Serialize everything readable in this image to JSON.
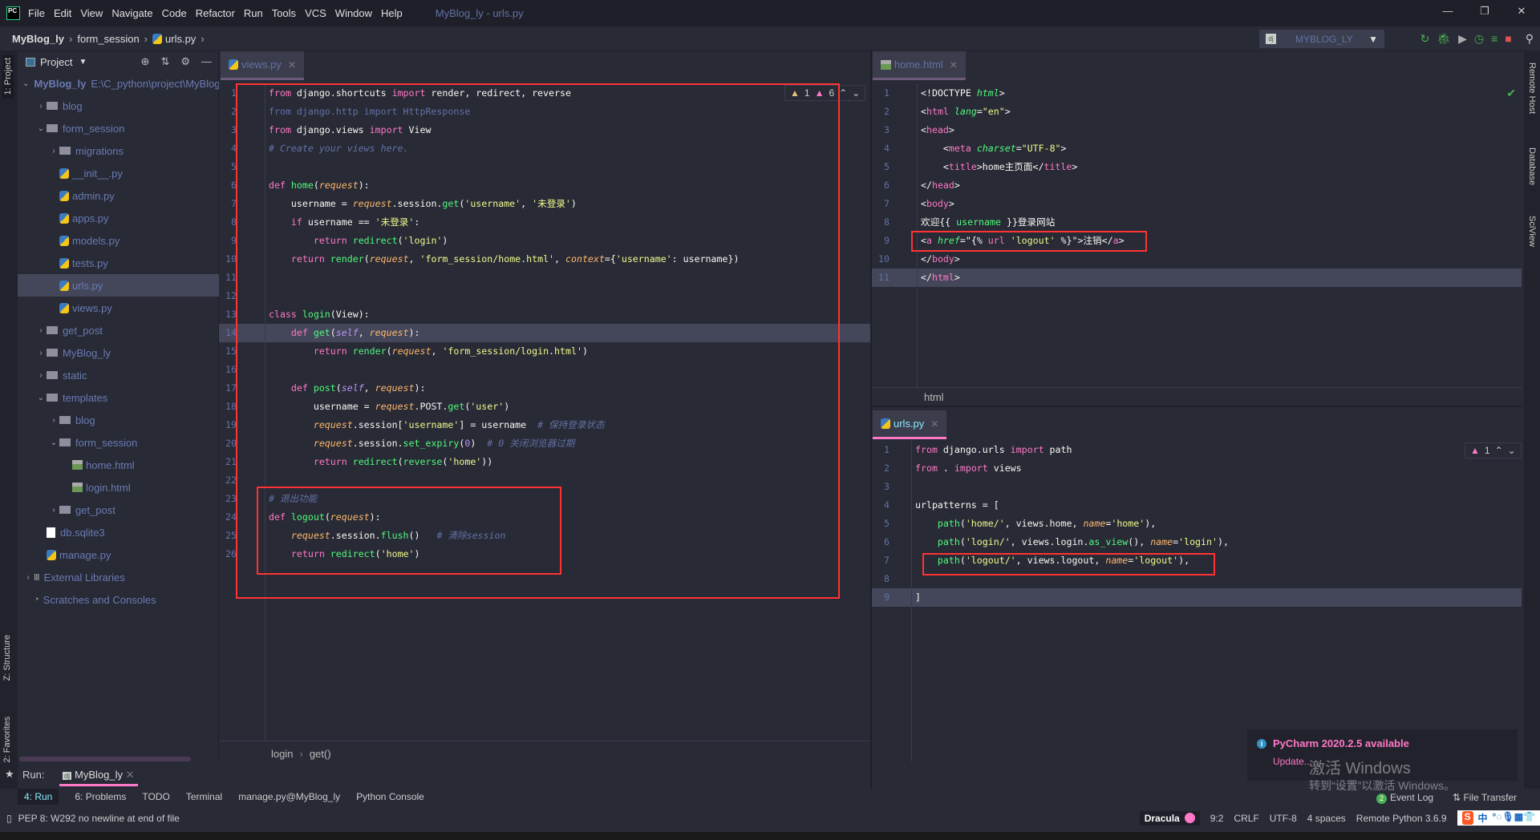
{
  "titlebar": {
    "logo": "PC",
    "menu": [
      "File",
      "Edit",
      "View",
      "Navigate",
      "Code",
      "Refactor",
      "Run",
      "Tools",
      "VCS",
      "Window",
      "Help"
    ],
    "title": "MyBlog_ly - urls.py"
  },
  "nav": {
    "crumbs": [
      "MyBlog_ly",
      "form_session",
      "urls.py"
    ],
    "run_config": "MYBLOG_LY"
  },
  "left_stripe": {
    "project": "1: Project",
    "structure": "Z: Structure",
    "favorites": "2: Favorites"
  },
  "right_stripe": {
    "remote": "Remote Host",
    "database": "Database",
    "sciview": "SciView"
  },
  "project": {
    "title": "Project",
    "items": [
      {
        "label": "MyBlog_ly",
        "path": "E:\\C_python\\project\\MyBlog_ly",
        "depth": 0,
        "kind": "root",
        "arrow": "open"
      },
      {
        "label": "blog",
        "depth": 1,
        "kind": "folder",
        "arrow": "closed"
      },
      {
        "label": "form_session",
        "depth": 1,
        "kind": "folder",
        "arrow": "open"
      },
      {
        "label": "migrations",
        "depth": 2,
        "kind": "folder",
        "arrow": "closed"
      },
      {
        "label": "__init__.py",
        "depth": 2,
        "kind": "py"
      },
      {
        "label": "admin.py",
        "depth": 2,
        "kind": "py"
      },
      {
        "label": "apps.py",
        "depth": 2,
        "kind": "py"
      },
      {
        "label": "models.py",
        "depth": 2,
        "kind": "py"
      },
      {
        "label": "tests.py",
        "depth": 2,
        "kind": "py"
      },
      {
        "label": "urls.py",
        "depth": 2,
        "kind": "py",
        "selected": true
      },
      {
        "label": "views.py",
        "depth": 2,
        "kind": "py"
      },
      {
        "label": "get_post",
        "depth": 1,
        "kind": "folder",
        "arrow": "closed"
      },
      {
        "label": "MyBlog_ly",
        "depth": 1,
        "kind": "folder",
        "arrow": "closed"
      },
      {
        "label": "static",
        "depth": 1,
        "kind": "folder",
        "arrow": "closed"
      },
      {
        "label": "templates",
        "depth": 1,
        "kind": "folder",
        "arrow": "open"
      },
      {
        "label": "blog",
        "depth": 2,
        "kind": "folder",
        "arrow": "closed"
      },
      {
        "label": "form_session",
        "depth": 2,
        "kind": "folder",
        "arrow": "open"
      },
      {
        "label": "home.html",
        "depth": 3,
        "kind": "html"
      },
      {
        "label": "login.html",
        "depth": 3,
        "kind": "html"
      },
      {
        "label": "get_post",
        "depth": 2,
        "kind": "folder",
        "arrow": "closed"
      },
      {
        "label": "db.sqlite3",
        "depth": 1,
        "kind": "db"
      },
      {
        "label": "manage.py",
        "depth": 1,
        "kind": "py"
      },
      {
        "label": "External Libraries",
        "depth": 0,
        "kind": "lib",
        "arrow": "closed"
      },
      {
        "label": "Scratches and Consoles",
        "depth": 0,
        "kind": "scratch"
      }
    ]
  },
  "editors": {
    "views": {
      "tab": "views.py",
      "warnings": "1",
      "weak_warnings": "6",
      "current_line": 14,
      "breadcrumb": [
        "login",
        "get()"
      ],
      "lines": [
        [
          [
            "k",
            "from"
          ],
          [
            "n",
            " django.shortcuts "
          ],
          [
            "k",
            "import"
          ],
          [
            "n",
            " render, redirect, reverse"
          ]
        ],
        [
          [
            "d",
            "from django.http import HttpResponse"
          ]
        ],
        [
          [
            "k",
            "from"
          ],
          [
            "n",
            " django.views "
          ],
          [
            "k",
            "import"
          ],
          [
            "n",
            " View"
          ]
        ],
        [
          [
            "c",
            "# Create your views here."
          ]
        ],
        [],
        [
          [
            "k",
            "def "
          ],
          [
            "f",
            "home"
          ],
          [
            "n",
            "("
          ],
          [
            "p",
            "request"
          ],
          [
            "n",
            "):"
          ]
        ],
        [
          [
            "n",
            "    username = "
          ],
          [
            "p",
            "request"
          ],
          [
            "n",
            ".session."
          ],
          [
            "f",
            "get"
          ],
          [
            "n",
            "("
          ],
          [
            "s",
            "'username'"
          ],
          [
            "n",
            ", "
          ],
          [
            "s",
            "'未登录'"
          ],
          [
            "n",
            ")"
          ]
        ],
        [
          [
            "n",
            "    "
          ],
          [
            "k",
            "if"
          ],
          [
            "n",
            " username == "
          ],
          [
            "s",
            "'未登录'"
          ],
          [
            "n",
            ":"
          ]
        ],
        [
          [
            "n",
            "        "
          ],
          [
            "k",
            "return "
          ],
          [
            "f",
            "redirect"
          ],
          [
            "n",
            "("
          ],
          [
            "s",
            "'login'"
          ],
          [
            "n",
            ")"
          ]
        ],
        [
          [
            "n",
            "    "
          ],
          [
            "k",
            "return "
          ],
          [
            "f",
            "render"
          ],
          [
            "n",
            "("
          ],
          [
            "p",
            "request"
          ],
          [
            "n",
            ", "
          ],
          [
            "s",
            "'form_session/home.html'"
          ],
          [
            "n",
            ", "
          ],
          [
            "p",
            "context"
          ],
          [
            "n",
            "={"
          ],
          [
            "s",
            "'username'"
          ],
          [
            "n",
            ": username})"
          ]
        ],
        [],
        [],
        [
          [
            "k",
            "class "
          ],
          [
            "f",
            "login"
          ],
          [
            "n",
            "(View):"
          ]
        ],
        [
          [
            "n",
            "    "
          ],
          [
            "k",
            "def "
          ],
          [
            "f",
            "get"
          ],
          [
            "n",
            "("
          ],
          [
            "b",
            "self"
          ],
          [
            "n",
            ", "
          ],
          [
            "p",
            "request"
          ],
          [
            "n",
            "):"
          ]
        ],
        [
          [
            "n",
            "        "
          ],
          [
            "k",
            "return "
          ],
          [
            "f",
            "render"
          ],
          [
            "n",
            "("
          ],
          [
            "p",
            "request"
          ],
          [
            "n",
            ", "
          ],
          [
            "s",
            "'form_session/login.html'"
          ],
          [
            "n",
            ")"
          ]
        ],
        [],
        [
          [
            "n",
            "    "
          ],
          [
            "k",
            "def "
          ],
          [
            "f",
            "post"
          ],
          [
            "n",
            "("
          ],
          [
            "b",
            "self"
          ],
          [
            "n",
            ", "
          ],
          [
            "p",
            "request"
          ],
          [
            "n",
            "):"
          ]
        ],
        [
          [
            "n",
            "        username = "
          ],
          [
            "p",
            "request"
          ],
          [
            "n",
            ".POST."
          ],
          [
            "f",
            "get"
          ],
          [
            "n",
            "("
          ],
          [
            "s",
            "'user'"
          ],
          [
            "n",
            ")"
          ]
        ],
        [
          [
            "n",
            "        "
          ],
          [
            "p",
            "request"
          ],
          [
            "n",
            ".session["
          ],
          [
            "s",
            "'username'"
          ],
          [
            "n",
            "] = username  "
          ],
          [
            "c",
            "# 保持登录状态"
          ]
        ],
        [
          [
            "n",
            "        "
          ],
          [
            "p",
            "request"
          ],
          [
            "n",
            ".session."
          ],
          [
            "f",
            "set_expiry"
          ],
          [
            "n",
            "("
          ],
          [
            "x",
            "0"
          ],
          [
            "n",
            ")  "
          ],
          [
            "c",
            "# 0 关闭浏览器过期"
          ]
        ],
        [
          [
            "n",
            "        "
          ],
          [
            "k",
            "return "
          ],
          [
            "f",
            "redirect"
          ],
          [
            "n",
            "("
          ],
          [
            "f",
            "reverse"
          ],
          [
            "n",
            "("
          ],
          [
            "s",
            "'home'"
          ],
          [
            "n",
            "))"
          ]
        ],
        [],
        [
          [
            "c",
            "# 退出功能"
          ]
        ],
        [
          [
            "k",
            "def "
          ],
          [
            "f",
            "logout"
          ],
          [
            "n",
            "("
          ],
          [
            "p",
            "request"
          ],
          [
            "n",
            "):"
          ]
        ],
        [
          [
            "n",
            "    "
          ],
          [
            "p",
            "request"
          ],
          [
            "n",
            ".session."
          ],
          [
            "f",
            "flush"
          ],
          [
            "n",
            "()   "
          ],
          [
            "c",
            "# 清除session"
          ]
        ],
        [
          [
            "n",
            "    "
          ],
          [
            "k",
            "return "
          ],
          [
            "f",
            "redirect"
          ],
          [
            "n",
            "("
          ],
          [
            "s",
            "'home'"
          ],
          [
            "n",
            ")"
          ]
        ]
      ]
    },
    "home": {
      "tab": "home.html",
      "current_line": 11,
      "breadcrumb": [
        "html"
      ],
      "lines": [
        [
          [
            "n",
            "<!DOCTYPE "
          ],
          [
            "a",
            "html"
          ],
          [
            "n",
            ">"
          ]
        ],
        [
          [
            "n",
            "<"
          ],
          [
            "t",
            "html"
          ],
          [
            "n",
            " "
          ],
          [
            "a",
            "lang"
          ],
          [
            "n",
            "="
          ],
          [
            "s",
            "\"en\""
          ],
          [
            "n",
            ">"
          ]
        ],
        [
          [
            "n",
            "<"
          ],
          [
            "t",
            "head"
          ],
          [
            "n",
            ">"
          ]
        ],
        [
          [
            "n",
            "    <"
          ],
          [
            "t",
            "meta"
          ],
          [
            "n",
            " "
          ],
          [
            "a",
            "charset"
          ],
          [
            "n",
            "="
          ],
          [
            "s",
            "\"UTF-8\""
          ],
          [
            "n",
            ">"
          ]
        ],
        [
          [
            "n",
            "    <"
          ],
          [
            "t",
            "title"
          ],
          [
            "n",
            ">home主页面</"
          ],
          [
            "t",
            "title"
          ],
          [
            "n",
            ">"
          ]
        ],
        [
          [
            "n",
            "</"
          ],
          [
            "t",
            "head"
          ],
          [
            "n",
            ">"
          ]
        ],
        [
          [
            "n",
            "<"
          ],
          [
            "t",
            "body"
          ],
          [
            "n",
            ">"
          ]
        ],
        [
          [
            "n",
            "欢迎{{ "
          ],
          [
            "f",
            "username"
          ],
          [
            "n",
            " }}登录网站"
          ]
        ],
        [
          [
            "n",
            "<"
          ],
          [
            "t",
            "a"
          ],
          [
            "n",
            " "
          ],
          [
            "a",
            "href"
          ],
          [
            "n",
            "=\"{% "
          ],
          [
            "t",
            "url"
          ],
          [
            "n",
            " "
          ],
          [
            "s",
            "'logout'"
          ],
          [
            "n",
            " %}\">注销</"
          ],
          [
            "t",
            "a"
          ],
          [
            "n",
            ">"
          ]
        ],
        [
          [
            "n",
            "</"
          ],
          [
            "t",
            "body"
          ],
          [
            "n",
            ">"
          ]
        ],
        [
          [
            "n",
            "</"
          ],
          [
            "t",
            "html"
          ],
          [
            "n",
            ">"
          ]
        ]
      ]
    },
    "urls": {
      "tab": "urls.py",
      "weak_warnings": "1",
      "current_line": 9,
      "lines": [
        [
          [
            "k",
            "from"
          ],
          [
            "n",
            " django.urls "
          ],
          [
            "k",
            "import"
          ],
          [
            "n",
            " path"
          ]
        ],
        [
          [
            "k",
            "from"
          ],
          [
            "n",
            " . "
          ],
          [
            "k",
            "import"
          ],
          [
            "n",
            " views"
          ]
        ],
        [],
        [
          [
            "n",
            "urlpatterns = ["
          ]
        ],
        [
          [
            "n",
            "    "
          ],
          [
            "f",
            "path"
          ],
          [
            "n",
            "("
          ],
          [
            "s",
            "'home/'"
          ],
          [
            "n",
            ", views.home, "
          ],
          [
            "p",
            "name"
          ],
          [
            "n",
            "="
          ],
          [
            "s",
            "'home'"
          ],
          [
            "n",
            "),"
          ]
        ],
        [
          [
            "n",
            "    "
          ],
          [
            "f",
            "path"
          ],
          [
            "n",
            "("
          ],
          [
            "s",
            "'login/'"
          ],
          [
            "n",
            ", views.login."
          ],
          [
            "f",
            "as_view"
          ],
          [
            "n",
            "(), "
          ],
          [
            "p",
            "name"
          ],
          [
            "n",
            "="
          ],
          [
            "s",
            "'login'"
          ],
          [
            "n",
            "),"
          ]
        ],
        [
          [
            "n",
            "    "
          ],
          [
            "f",
            "path"
          ],
          [
            "n",
            "("
          ],
          [
            "s",
            "'logout/'"
          ],
          [
            "n",
            ", views.logout, "
          ],
          [
            "p",
            "name"
          ],
          [
            "n",
            "="
          ],
          [
            "s",
            "'logout'"
          ],
          [
            "n",
            "),"
          ]
        ],
        [],
        [
          [
            "n",
            "]"
          ]
        ]
      ]
    }
  },
  "run": {
    "label": "Run:",
    "tab": "MyBlog_ly"
  },
  "toolwindows": [
    "4: Run",
    "6: Problems",
    "TODO",
    "Terminal",
    "manage.py@MyBlog_ly",
    "Python Console"
  ],
  "status": {
    "message": "PEP 8: W292 no newline at end of file",
    "theme": "Dracula",
    "position": "9:2",
    "line_sep": "CRLF",
    "encoding": "UTF-8",
    "indent": "4 spaces",
    "interpreter": "Remote Python 3.6.9"
  },
  "event_log": {
    "count": "2",
    "label": "Event Log",
    "file_transfer": "File Transfer"
  },
  "notification": {
    "title": "PyCharm 2020.2.5 available",
    "action": "Update..."
  },
  "watermark": {
    "line1": "激活 Windows",
    "line2": "转到“设置”以激活 Windows。"
  },
  "ime": {
    "lang": "中"
  },
  "colors": {
    "accent": "#ff79c6",
    "background": "#282a36",
    "highlight_box": "#ff3333"
  }
}
